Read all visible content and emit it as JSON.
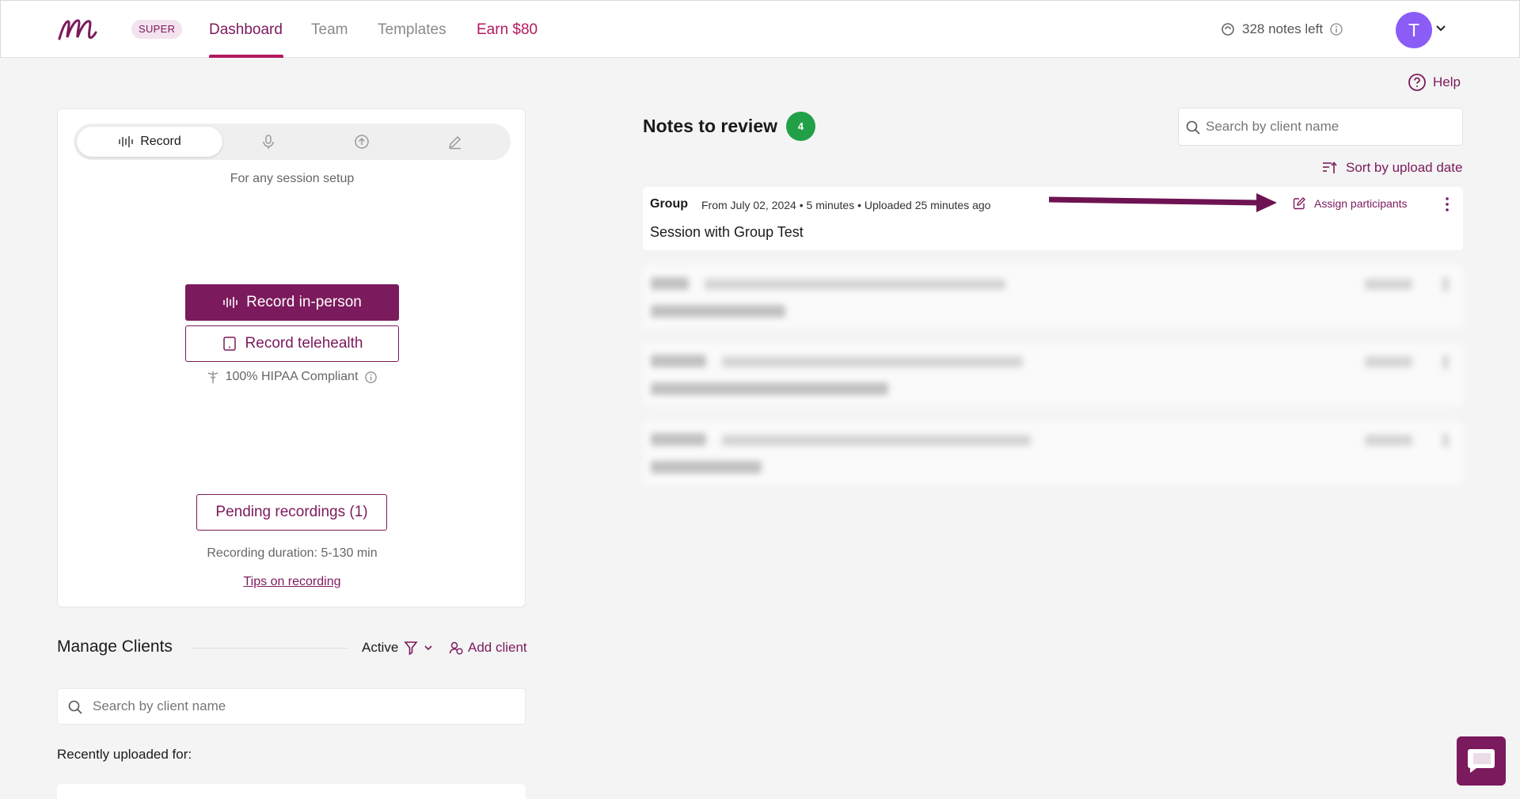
{
  "nav": {
    "plan_badge": "SUPER",
    "tabs": [
      {
        "label": "Dashboard"
      },
      {
        "label": "Team"
      },
      {
        "label": "Templates"
      },
      {
        "label": "Earn $80"
      }
    ],
    "notes_left": "328 notes left",
    "avatar_initial": "T"
  },
  "help_label": "Help",
  "recorder": {
    "mode_label": "Record",
    "subtitle": "For any session setup",
    "record_in_person": "Record in-person",
    "record_telehealth": "Record telehealth",
    "hipaa": "100% HIPAA Compliant",
    "pending": "Pending recordings (1)",
    "duration": "Recording duration: 5-130 min",
    "tips": "Tips on recording"
  },
  "manage_clients": {
    "title": "Manage Clients",
    "filter_label": "Active",
    "add_client": "Add client",
    "search_placeholder": "Search by client name",
    "recently_label": "Recently uploaded for:"
  },
  "notes_review": {
    "title": "Notes to review",
    "count": "4",
    "search_placeholder": "Search by client name",
    "sort_label": "Sort by upload date",
    "notes": [
      {
        "type": "Group",
        "meta": "From July 02, 2024 • 5 minutes • Uploaded 25 minutes ago",
        "title": "Session with Group Test",
        "action": "Assign participants"
      }
    ]
  },
  "colors": {
    "brand": "#7b1a5c",
    "accent": "#b3195f",
    "success": "#22a047",
    "avatar": "#8b5cf6"
  }
}
